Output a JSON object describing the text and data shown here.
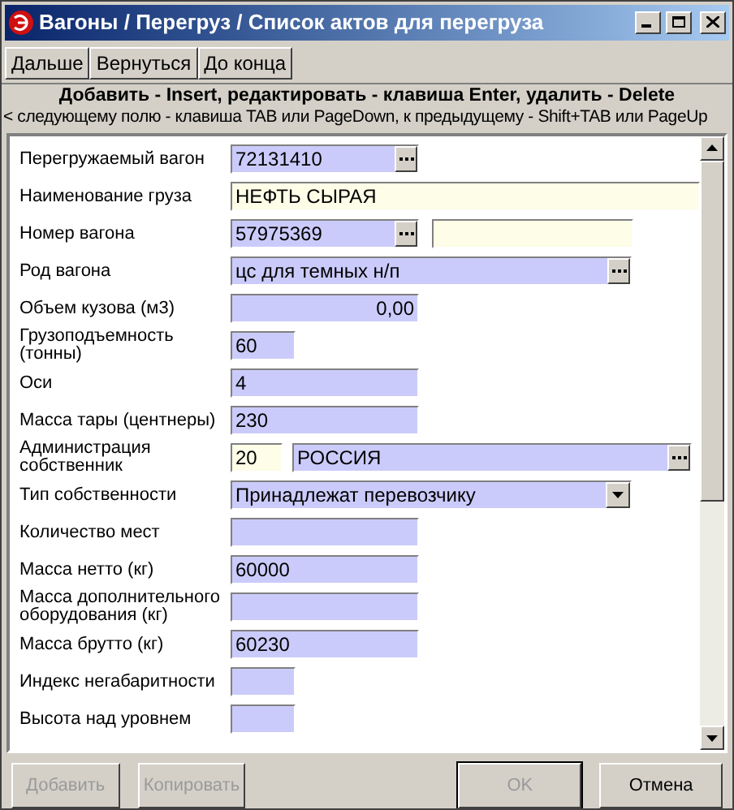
{
  "window": {
    "title": "Вагоны / Перегруз / Список  актов для перегруза"
  },
  "toolbar": [
    "Дальше",
    "Вернуться",
    "До конца"
  ],
  "help": {
    "line_1": "Добавить - Insert, редактировать - клавиша Enter, удалить - Delete",
    "line_2": "< следующему полю - клавиша TAB или PageDown, к предыдущему - Shift+TAB или PageUp"
  },
  "form": [
    {
      "label": "Перегружаемый вагон",
      "fields": [
        {
          "kind": "lookup",
          "readonly": false,
          "value": "72131410"
        }
      ]
    },
    {
      "label": "Наименование груза",
      "fields": [
        {
          "kind": "text",
          "readonly": true,
          "value": "НЕФТЬ СЫРАЯ"
        }
      ]
    },
    {
      "label": "Номер вагона",
      "fields": [
        {
          "kind": "lookup",
          "readonly": false,
          "value": "57975369"
        },
        {
          "kind": "text",
          "readonly": true
        }
      ]
    },
    {
      "label": "Род вагона",
      "fields": [
        {
          "kind": "lookup",
          "readonly": false,
          "value": "цс для темных  н/п"
        }
      ]
    },
    {
      "label": "Объем кузова (м3)",
      "fields": [
        {
          "kind": "number",
          "readonly": false,
          "value": "0,00"
        }
      ]
    },
    {
      "label": "Грузоподъемность (тонны)",
      "fields": [
        {
          "kind": "text",
          "readonly": false,
          "value": "60"
        }
      ]
    },
    {
      "label": "Оси",
      "fields": [
        {
          "kind": "text",
          "readonly": false,
          "value": "4"
        }
      ]
    },
    {
      "label": "Масса тары (центнеры)",
      "fields": [
        {
          "kind": "text",
          "readonly": false,
          "value": "230"
        }
      ]
    },
    {
      "label": "Администрация собственник",
      "fields": [
        {
          "kind": "text",
          "readonly": true,
          "value": "20"
        },
        {
          "kind": "lookup",
          "readonly": false,
          "value": "РОССИЯ"
        }
      ]
    },
    {
      "label": "Тип собственности",
      "fields": [
        {
          "kind": "dropdown",
          "readonly": false,
          "value": "Принадлежат перевозчику"
        }
      ]
    },
    {
      "label": "Количество мест",
      "fields": [
        {
          "kind": "text",
          "readonly": false
        }
      ]
    },
    {
      "label": "Масса нетто (кг)",
      "fields": [
        {
          "kind": "text",
          "readonly": false,
          "value": "60000"
        }
      ]
    },
    {
      "label": "Масса дополнительного оборудования (кг)",
      "fields": [
        {
          "kind": "text",
          "readonly": false
        }
      ]
    },
    {
      "label": "Масса брутто (кг)",
      "fields": [
        {
          "kind": "text",
          "readonly": false,
          "value": "60230"
        }
      ]
    },
    {
      "label": "Индекс негабаритности",
      "fields": [
        {
          "kind": "text",
          "readonly": false
        }
      ]
    },
    {
      "label": "Высота над уровнем",
      "fields": [
        {
          "kind": "text",
          "readonly": false
        }
      ]
    }
  ],
  "buttons": [
    {
      "label": "Добавить",
      "disabled": true,
      "default": false
    },
    {
      "label": "Копировать",
      "disabled": true,
      "default": false
    },
    {
      "label": "OK",
      "disabled": true,
      "default": true
    },
    {
      "label": "Отмена",
      "disabled": false,
      "default": false
    }
  ]
}
